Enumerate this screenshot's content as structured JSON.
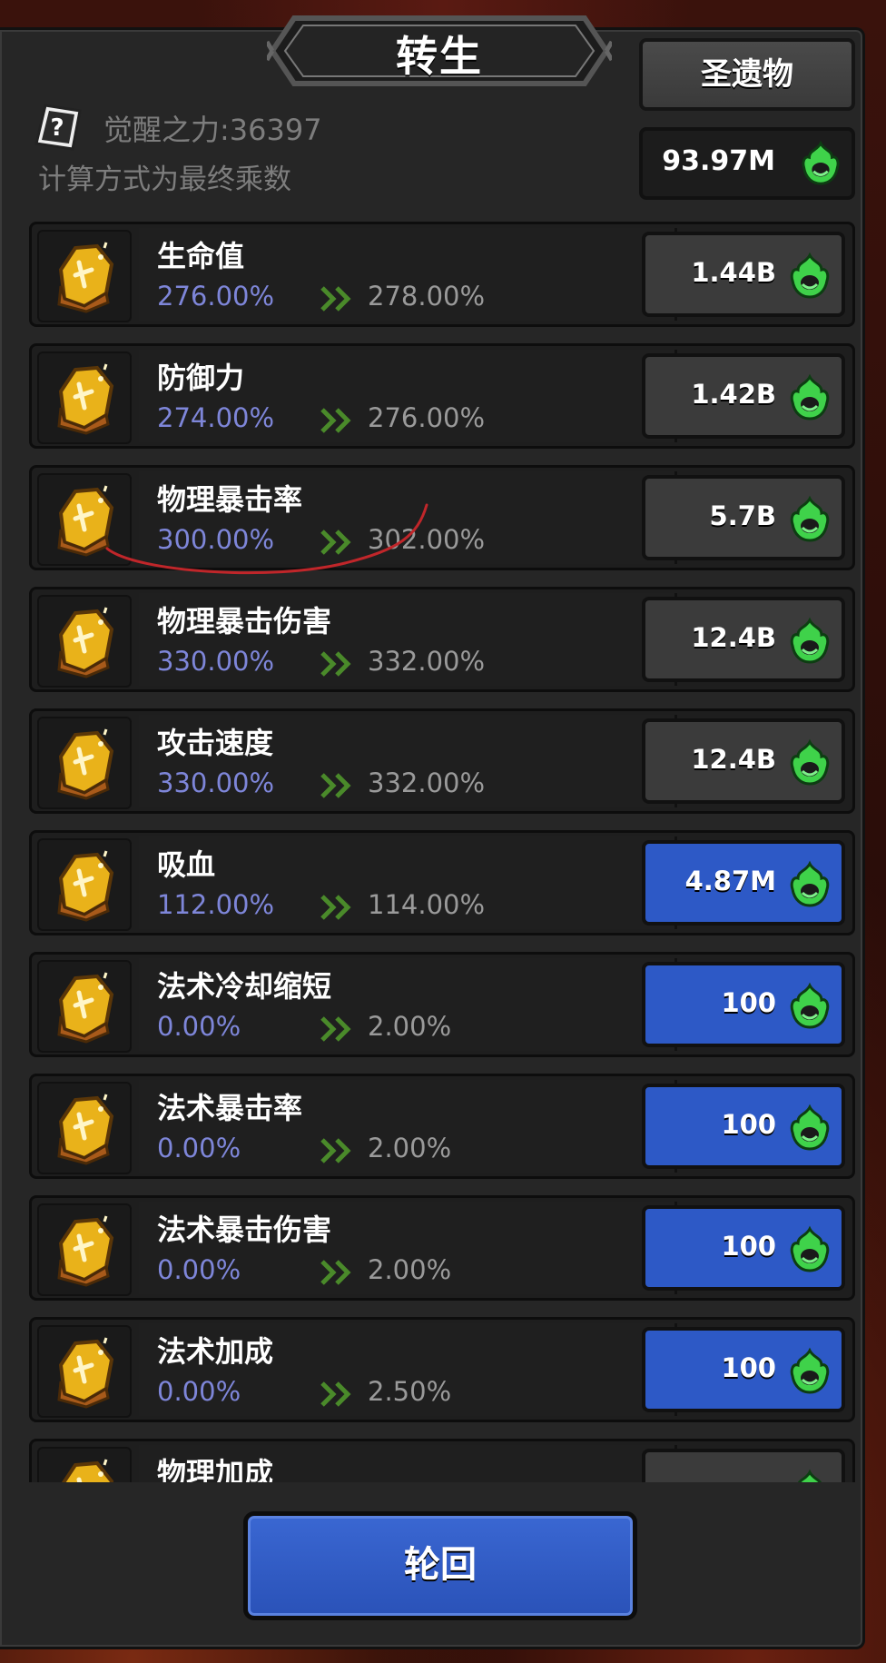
{
  "header": {
    "title": "转生",
    "relic_button": "圣遗物",
    "awaken_power": "觉醒之力:36397",
    "calc_note": "计算方式为最终乘数",
    "currency": "93.97M",
    "help_icon": "question-mark-icon",
    "currency_icon": "green-flame-icon"
  },
  "rows": [
    {
      "name": "生命值",
      "current": "276.00%",
      "next": "278.00%",
      "cost": "1.44B",
      "style": "gray"
    },
    {
      "name": "防御力",
      "current": "274.00%",
      "next": "276.00%",
      "cost": "1.42B",
      "style": "gray"
    },
    {
      "name": "物理暴击率",
      "current": "300.00%",
      "next": "302.00%",
      "cost": "5.7B",
      "style": "gray"
    },
    {
      "name": "物理暴击伤害",
      "current": "330.00%",
      "next": "332.00%",
      "cost": "12.4B",
      "style": "gray"
    },
    {
      "name": "攻击速度",
      "current": "330.00%",
      "next": "332.00%",
      "cost": "12.4B",
      "style": "gray"
    },
    {
      "name": "吸血",
      "current": "112.00%",
      "next": "114.00%",
      "cost": "4.87M",
      "style": "blue"
    },
    {
      "name": "法术冷却缩短",
      "current": "0.00%",
      "next": "2.00%",
      "cost": "100",
      "style": "blue"
    },
    {
      "name": "法术暴击率",
      "current": "0.00%",
      "next": "2.00%",
      "cost": "100",
      "style": "blue"
    },
    {
      "name": "法术暴击伤害",
      "current": "0.00%",
      "next": "2.00%",
      "cost": "100",
      "style": "blue"
    },
    {
      "name": "法术加成",
      "current": "0.00%",
      "next": "2.50%",
      "cost": "100",
      "style": "blue"
    },
    {
      "name": "物理加成",
      "current": "",
      "next": "",
      "cost": "",
      "style": "gray"
    }
  ],
  "footer": {
    "reincarnate_button": "轮回"
  },
  "colors": {
    "current_value": "#7e86d9",
    "next_value": "#9a9a9a",
    "blue_button": "#2d59c6",
    "gray_button": "#3b3b3b",
    "annotation_stroke": "#c0262a"
  }
}
